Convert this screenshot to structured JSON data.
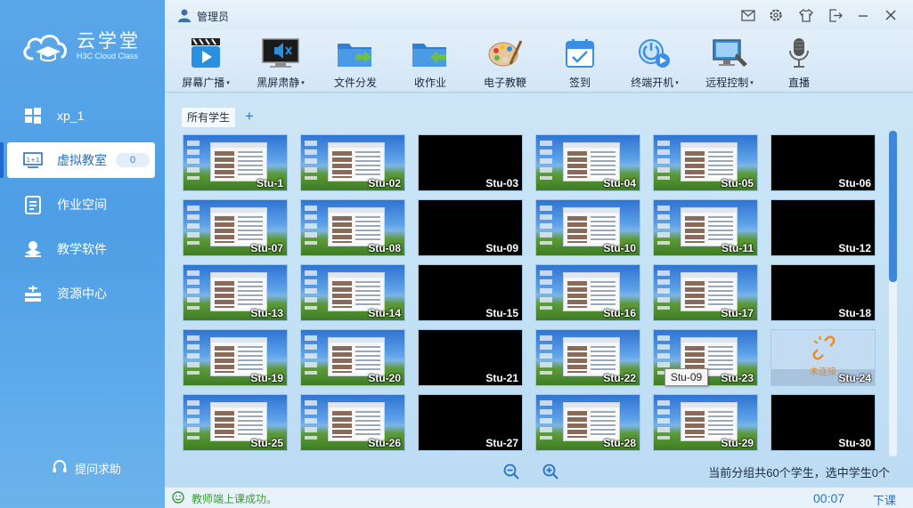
{
  "app": {
    "name": "云学堂",
    "subtitle": "H3C Cloud Class",
    "user": "管理员"
  },
  "sidebar": {
    "items": [
      {
        "label": "xp_1",
        "icon": "windows-icon"
      },
      {
        "label": "虚拟教室",
        "icon": "classroom-icon",
        "badge": "0",
        "active": true
      },
      {
        "label": "作业空间",
        "icon": "homework-icon"
      },
      {
        "label": "教学软件",
        "icon": "software-icon"
      },
      {
        "label": "资源中心",
        "icon": "resource-icon"
      }
    ],
    "help_label": "提问求助"
  },
  "toolbar": {
    "items": [
      {
        "label": "屏幕广播",
        "dropdown": true,
        "icon": "screen-broadcast-icon"
      },
      {
        "label": "黑屏肃静",
        "dropdown": true,
        "icon": "black-screen-icon"
      },
      {
        "label": "文件分发",
        "dropdown": false,
        "icon": "file-distribute-icon"
      },
      {
        "label": "收作业",
        "dropdown": false,
        "icon": "collect-homework-icon"
      },
      {
        "label": "电子教鞭",
        "dropdown": false,
        "icon": "palette-icon"
      },
      {
        "label": "签到",
        "dropdown": false,
        "icon": "calendar-signin-icon"
      },
      {
        "label": "终端开机",
        "dropdown": true,
        "icon": "power-on-icon"
      },
      {
        "label": "远程控制",
        "dropdown": true,
        "icon": "remote-control-icon"
      },
      {
        "label": "直播",
        "dropdown": false,
        "icon": "microphone-icon"
      }
    ],
    "dropdown_arrow": "▾"
  },
  "main": {
    "group_tab": "所有学生",
    "add_group": "+",
    "tooltip": "Stu-09",
    "offline_label": "未连接",
    "summary": "当前分组共60个学生，选中学生0个",
    "students": [
      {
        "name": "Stu-1",
        "state": "desktop"
      },
      {
        "name": "Stu-02",
        "state": "desktop"
      },
      {
        "name": "Stu-03",
        "state": "black"
      },
      {
        "name": "Stu-04",
        "state": "desktop"
      },
      {
        "name": "Stu-05",
        "state": "desktop"
      },
      {
        "name": "Stu-06",
        "state": "black"
      },
      {
        "name": "Stu-07",
        "state": "desktop"
      },
      {
        "name": "Stu-08",
        "state": "desktop"
      },
      {
        "name": "Stu-09",
        "state": "black"
      },
      {
        "name": "Stu-10",
        "state": "desktop"
      },
      {
        "name": "Stu-11",
        "state": "desktop"
      },
      {
        "name": "Stu-12",
        "state": "black"
      },
      {
        "name": "Stu-13",
        "state": "desktop"
      },
      {
        "name": "Stu-14",
        "state": "desktop"
      },
      {
        "name": "Stu-15",
        "state": "black"
      },
      {
        "name": "Stu-16",
        "state": "desktop"
      },
      {
        "name": "Stu-17",
        "state": "desktop"
      },
      {
        "name": "Stu-18",
        "state": "black"
      },
      {
        "name": "Stu-19",
        "state": "desktop"
      },
      {
        "name": "Stu-20",
        "state": "desktop"
      },
      {
        "name": "Stu-21",
        "state": "black"
      },
      {
        "name": "Stu-22",
        "state": "desktop"
      },
      {
        "name": "Stu-23",
        "state": "desktop"
      },
      {
        "name": "Stu-24",
        "state": "offline"
      },
      {
        "name": "Stu-25",
        "state": "desktop"
      },
      {
        "name": "Stu-26",
        "state": "desktop"
      },
      {
        "name": "Stu-27",
        "state": "black"
      },
      {
        "name": "Stu-28",
        "state": "desktop"
      },
      {
        "name": "Stu-29",
        "state": "desktop"
      },
      {
        "name": "Stu-30",
        "state": "black"
      }
    ]
  },
  "status": {
    "message": "教师端上课成功。",
    "timer": "00:07",
    "end_class": "下课"
  },
  "colors": {
    "accent": "#2873c6",
    "sidebar": "#4e9ee6",
    "success": "#3a9c2e",
    "offline": "#f08a1c"
  }
}
